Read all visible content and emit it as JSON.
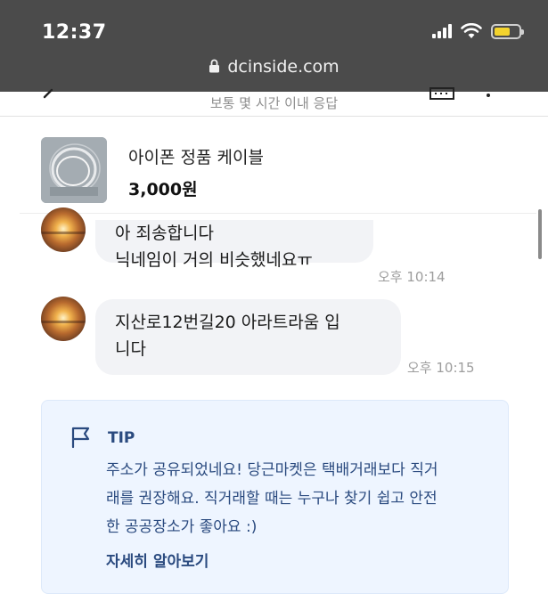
{
  "status_bar": {
    "time": "12:37",
    "url": "dcinside.com",
    "battery_level": 0.65,
    "icons": [
      "signal-icon",
      "wifi-icon",
      "battery-icon",
      "lock-icon"
    ]
  },
  "header": {
    "subtitle": "보통 몇 시간 이내 응답",
    "icons": [
      "back-arrow-icon",
      "menu-icon",
      "more-icon"
    ]
  },
  "product": {
    "name": "아이폰 정품 케이블",
    "price": "3,000원"
  },
  "messages": [
    {
      "text": "아 죄송합니다\n닉네임이 거의 비슷했네요ㅠ",
      "time": "오후 10:14"
    },
    {
      "text": "지산로12번길20 아라트라움 입\n니다",
      "time": "오후 10:15"
    }
  ],
  "tip": {
    "title": "TIP",
    "body": "주소가 공유되었네요! 당근마켓은 택배거래보다 직거\n래를 권장해요. 직거래할 때는 누구나 찾기 쉽고 안전\n한 공공장소가 좋아요 :)",
    "link": "자세히 알아보기",
    "accent_color": "#2a4a7f",
    "background_color": "#eef5ff"
  }
}
